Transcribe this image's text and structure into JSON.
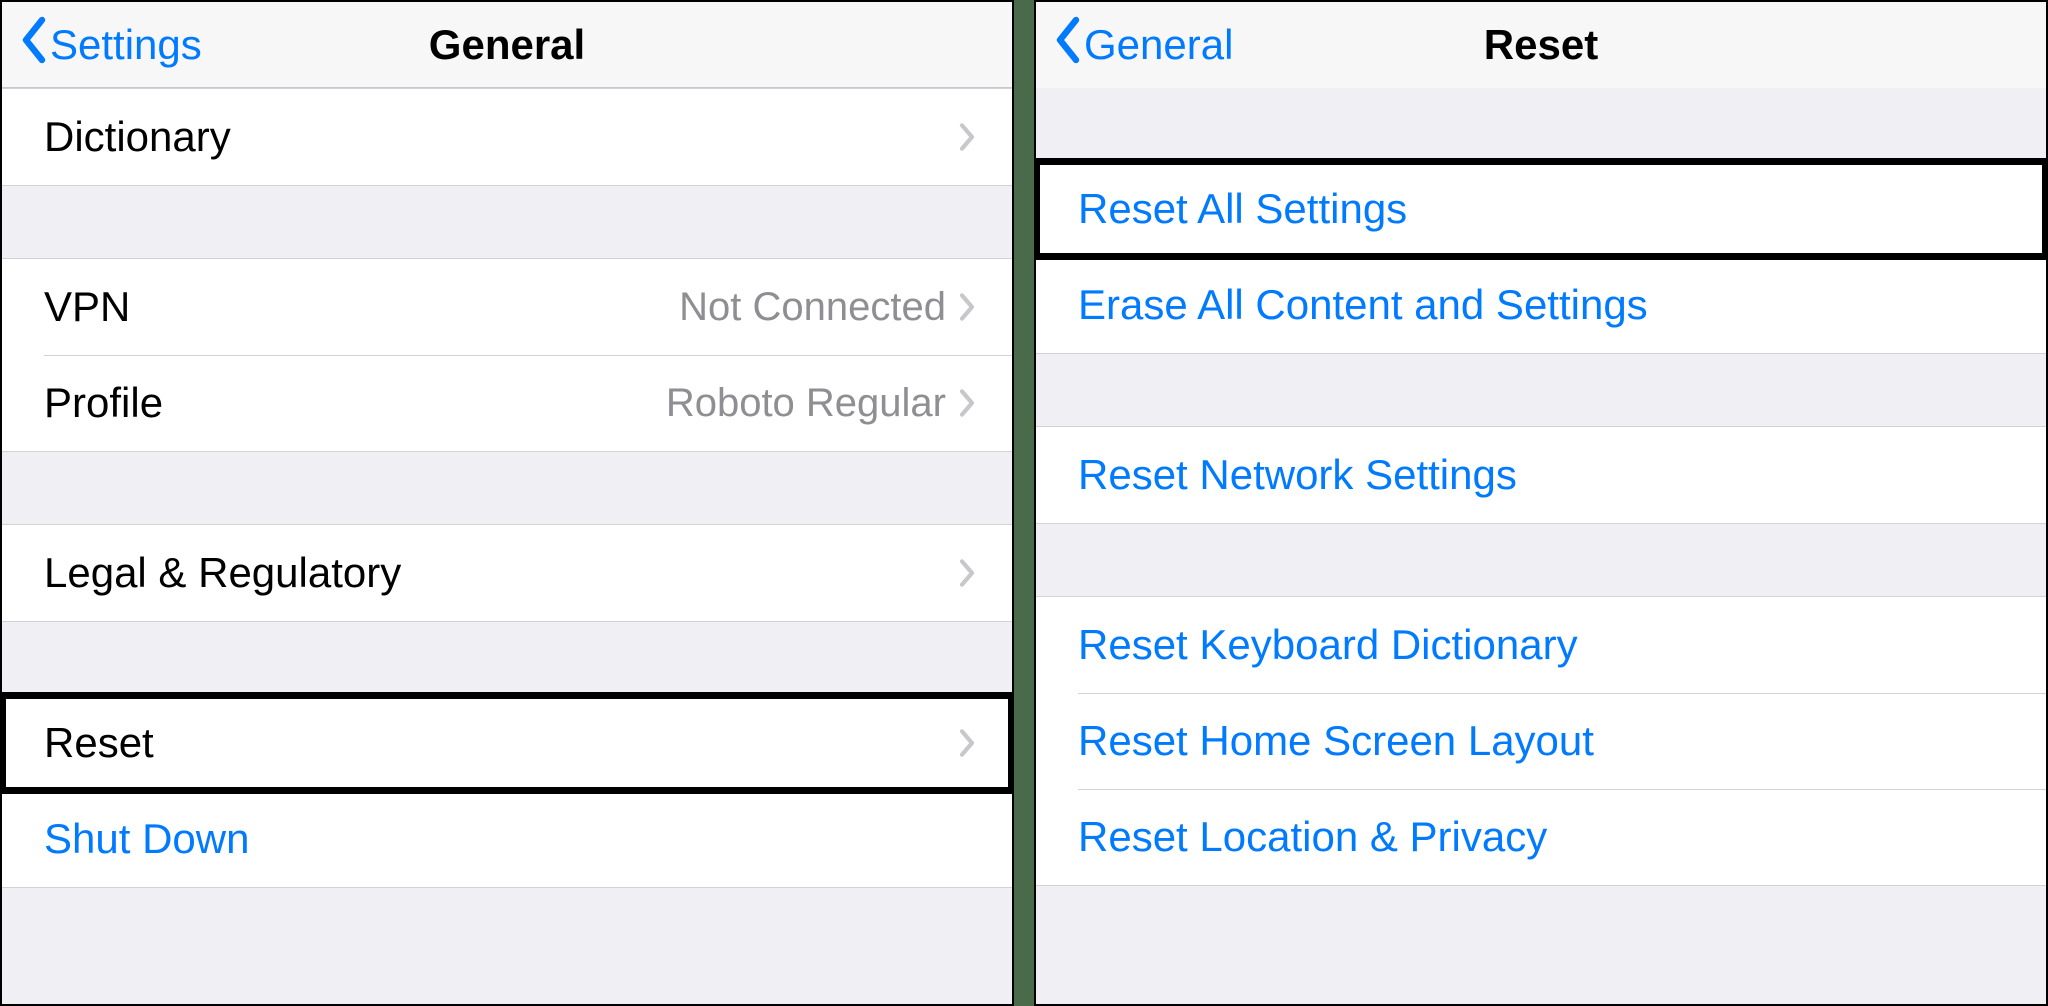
{
  "left": {
    "back_label": "Settings",
    "title": "General",
    "groups": [
      {
        "rows": [
          {
            "label": "Dictionary",
            "value": "",
            "chevron": true,
            "link": false,
            "highlight": false
          }
        ]
      },
      {
        "rows": [
          {
            "label": "VPN",
            "value": "Not Connected",
            "chevron": true,
            "link": false,
            "highlight": false
          },
          {
            "label": "Profile",
            "value": "Roboto Regular",
            "chevron": true,
            "link": false,
            "highlight": false
          }
        ]
      },
      {
        "rows": [
          {
            "label": "Legal & Regulatory",
            "value": "",
            "chevron": true,
            "link": false,
            "highlight": false
          }
        ]
      },
      {
        "rows": [
          {
            "label": "Reset",
            "value": "",
            "chevron": true,
            "link": false,
            "highlight": true
          },
          {
            "label": "Shut Down",
            "value": "",
            "chevron": false,
            "link": true,
            "highlight": false
          }
        ]
      }
    ]
  },
  "right": {
    "back_label": "General",
    "title": "Reset",
    "groups": [
      {
        "rows": [
          {
            "label": "Reset All Settings",
            "link": true,
            "highlight": true
          },
          {
            "label": "Erase All Content and Settings",
            "link": true,
            "highlight": false
          }
        ]
      },
      {
        "rows": [
          {
            "label": "Reset Network Settings",
            "link": true,
            "highlight": false
          }
        ]
      },
      {
        "rows": [
          {
            "label": "Reset Keyboard Dictionary",
            "link": true,
            "highlight": false
          },
          {
            "label": "Reset Home Screen Layout",
            "link": true,
            "highlight": false
          },
          {
            "label": "Reset Location & Privacy",
            "link": true,
            "highlight": false
          }
        ]
      }
    ]
  }
}
